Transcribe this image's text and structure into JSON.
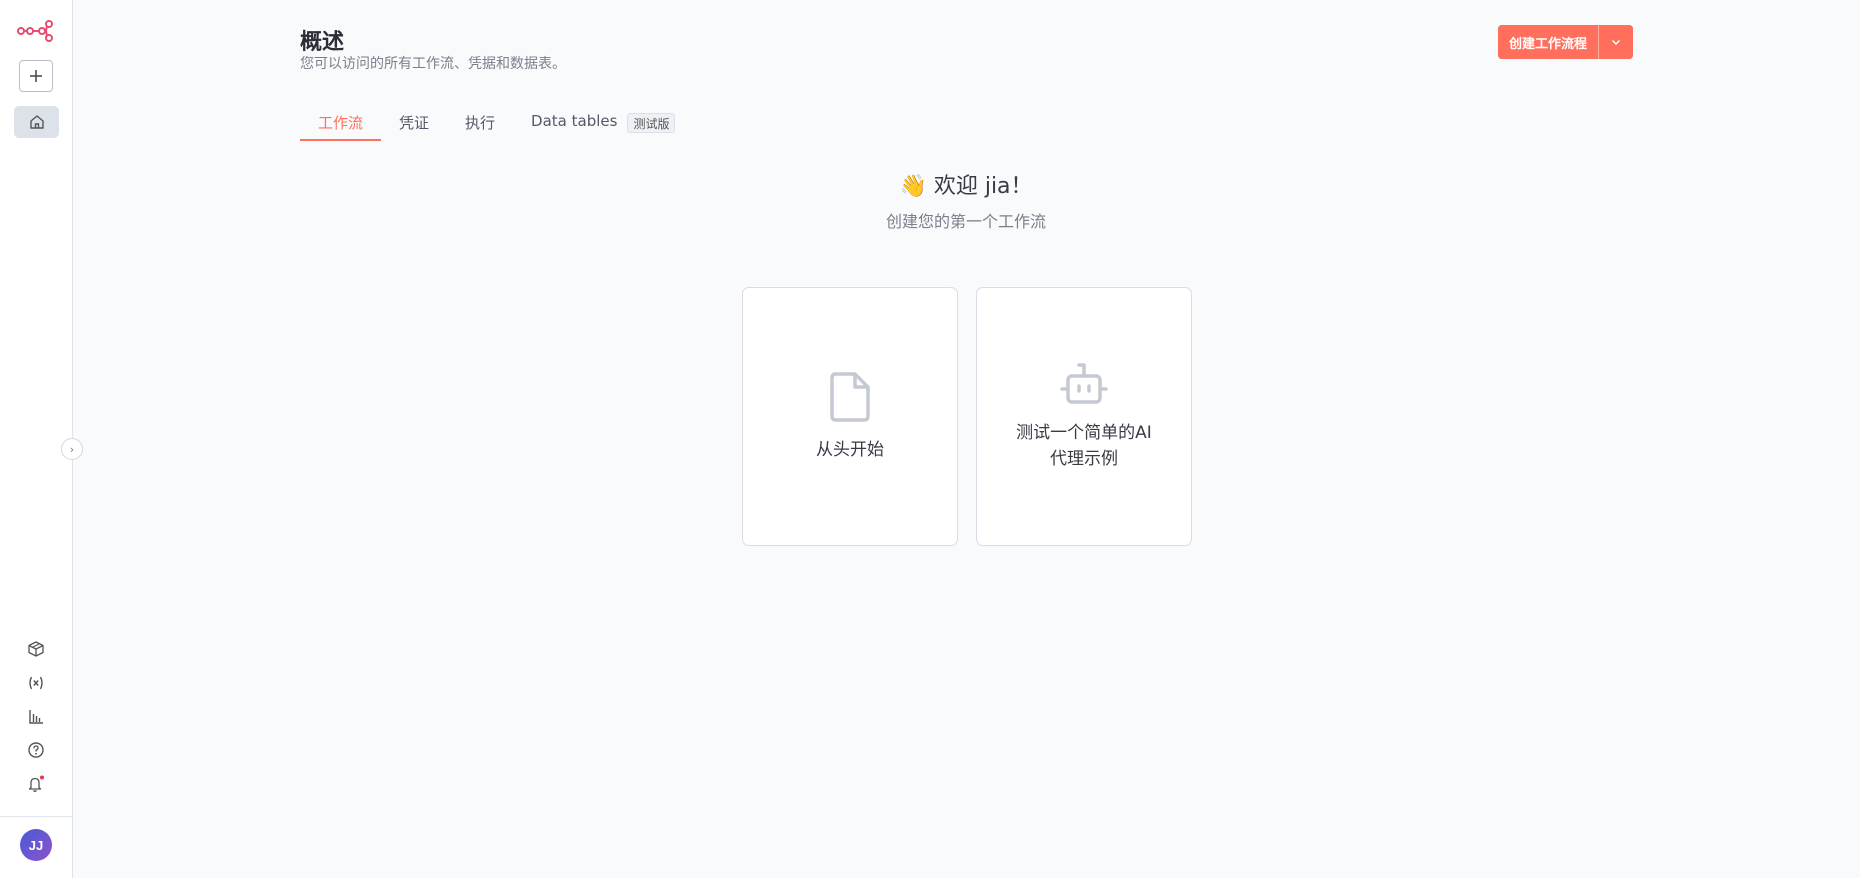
{
  "sidebar": {
    "logo_icon": "n8n-logo-icon",
    "add_icon": "plus-icon",
    "home_icon": "home-icon",
    "bottom_icons": [
      "cube-icon",
      "variables-icon",
      "bar-chart-icon",
      "help-circle-icon",
      "bell-icon"
    ],
    "notification_dot_color": "#e63946",
    "avatar_initials": "JJ",
    "collapse_icon": "chevron-right-icon",
    "collapse_glyph": "›"
  },
  "header": {
    "title": "概述",
    "subtitle": "您可以访问的所有工作流、凭据和数据表。",
    "create_button_label": "创建工作流程",
    "dropdown_icon": "chevron-down-icon"
  },
  "tabs": [
    {
      "label": "工作流",
      "active": true
    },
    {
      "label": "凭证",
      "active": false
    },
    {
      "label": "执行",
      "active": false
    },
    {
      "label": "Data tables",
      "active": false,
      "badge": "测试版"
    }
  ],
  "welcome": {
    "emoji": "👋",
    "greeting": "欢迎 jia！",
    "subtitle": "创建您的第一个工作流"
  },
  "cards": [
    {
      "icon": "file-icon",
      "label": "从头开始"
    },
    {
      "icon": "robot-icon",
      "label": "测试一个简单的AI代理示例"
    }
  ],
  "colors": {
    "accent": "#ff6f5c",
    "logo": "#ea4b71",
    "background": "#f9fafc"
  }
}
